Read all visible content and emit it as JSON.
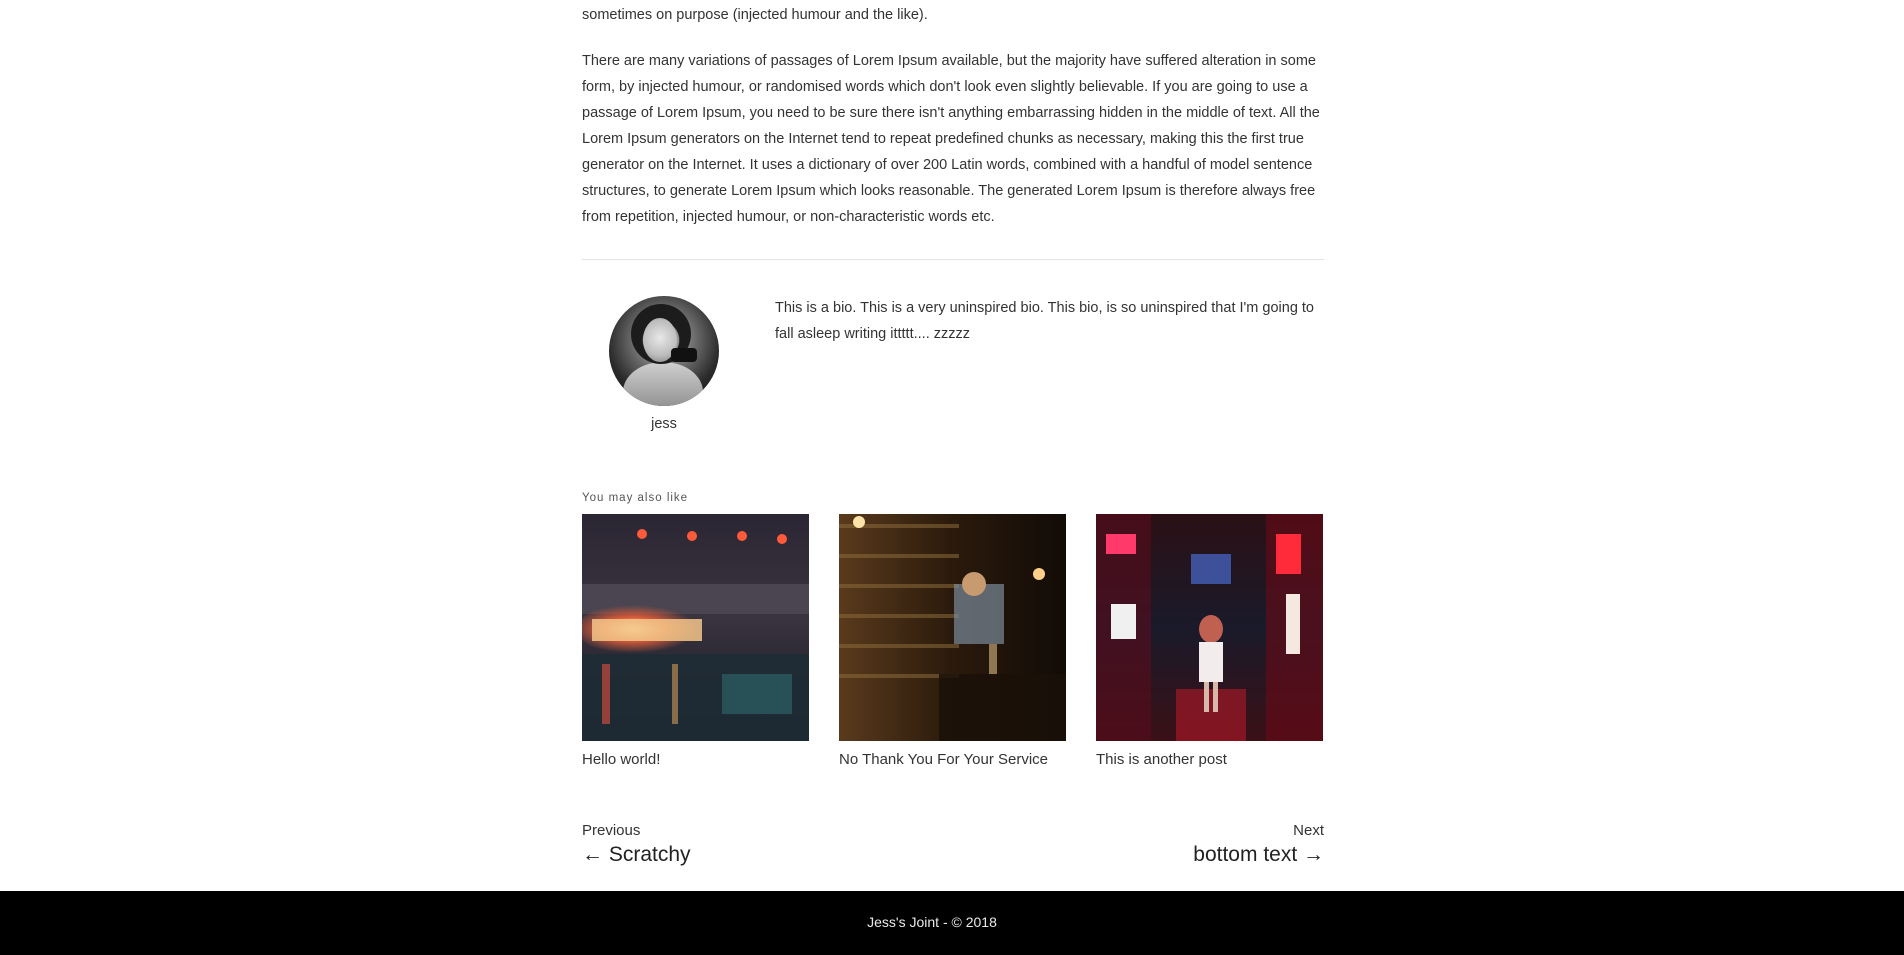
{
  "article": {
    "para_top": "sometimes on purpose (injected humour and the like).",
    "para_main": "There are many variations of passages of Lorem Ipsum available, but the majority have suffered alteration in some form, by injected humour, or randomised words which don't look even slightly believable. If you are going to use a passage of Lorem Ipsum, you need to be sure there isn't anything embarrassing hidden in the middle of text. All the Lorem Ipsum generators on the Internet tend to repeat predefined chunks as necessary, making this the first true generator on the Internet. It uses a dictionary of over 200 Latin words, combined with a handful of model sentence structures, to generate Lorem Ipsum which looks reasonable. The generated Lorem Ipsum is therefore always free from repetition, injected humour, or non-characteristic words etc."
  },
  "author": {
    "name": "jess",
    "bio": "This is a bio. This is a very uninspired bio. This bio, is so uninspired that I'm going to fall asleep writing ittttt.... zzzzz"
  },
  "related": {
    "heading": "You may also like",
    "posts": [
      {
        "title": "Hello world!"
      },
      {
        "title": "No Thank You For Your Service"
      },
      {
        "title": "This is another post"
      }
    ]
  },
  "post_nav": {
    "previous_label": "Previous",
    "previous_title": "← Scratchy",
    "next_label": "Next",
    "next_title": "bottom text →"
  },
  "footer": {
    "text": "Jess's Joint - © 2018"
  }
}
